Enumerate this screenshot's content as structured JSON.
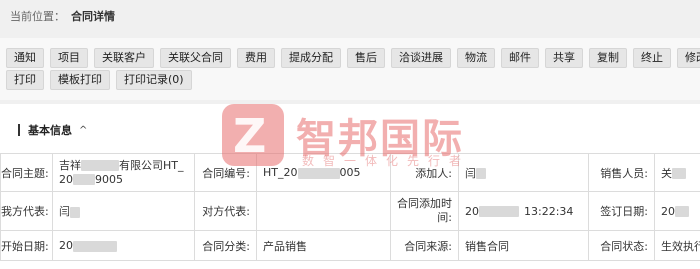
{
  "breadcrumb": {
    "label": "当前位置：",
    "current": "合同详情"
  },
  "toolbar": {
    "row1": [
      "通知",
      "项目",
      "关联客户",
      "关联父合同",
      "费用",
      "提成分配",
      "售后",
      "洽谈进展",
      "物流",
      "邮件",
      "共享",
      "复制",
      "终止",
      "修改"
    ],
    "row2": [
      "打印",
      "模板打印",
      "打印记录(0)"
    ]
  },
  "section": {
    "title": "基本信息",
    "chevron": "^"
  },
  "info": {
    "subject_label": "合同主题:",
    "subject_value_a": "吉祥",
    "subject_value_b": "有限公司HT_",
    "subject_value_c": "20",
    "subject_value_d": "9005",
    "code_label": "合同编号:",
    "code_value_a": "HT_20",
    "code_value_b": "005",
    "adder_label": "添加人:",
    "adder_value": "闫",
    "sales_label": "销售人员:",
    "sales_value": "关",
    "our_rep_label": "我方代表:",
    "our_rep_value": "闫",
    "their_rep_label": "对方代表:",
    "their_rep_value": "",
    "add_time_label": "合同添加时间:",
    "add_time_value_a": "20",
    "add_time_value_b": "13:22:34",
    "sign_date_label": "签订日期:",
    "sign_date_value": "20",
    "start_date_label": "开始日期:",
    "start_date_value": "20",
    "category_label": "合同分类:",
    "category_value": "产品销售",
    "source_label": "合同来源:",
    "source_value": "销售合同",
    "status_label": "合同状态:",
    "status_value": "生效执行"
  },
  "watermark": {
    "name": "智邦国际",
    "slogan": "数智一体化先行者"
  }
}
